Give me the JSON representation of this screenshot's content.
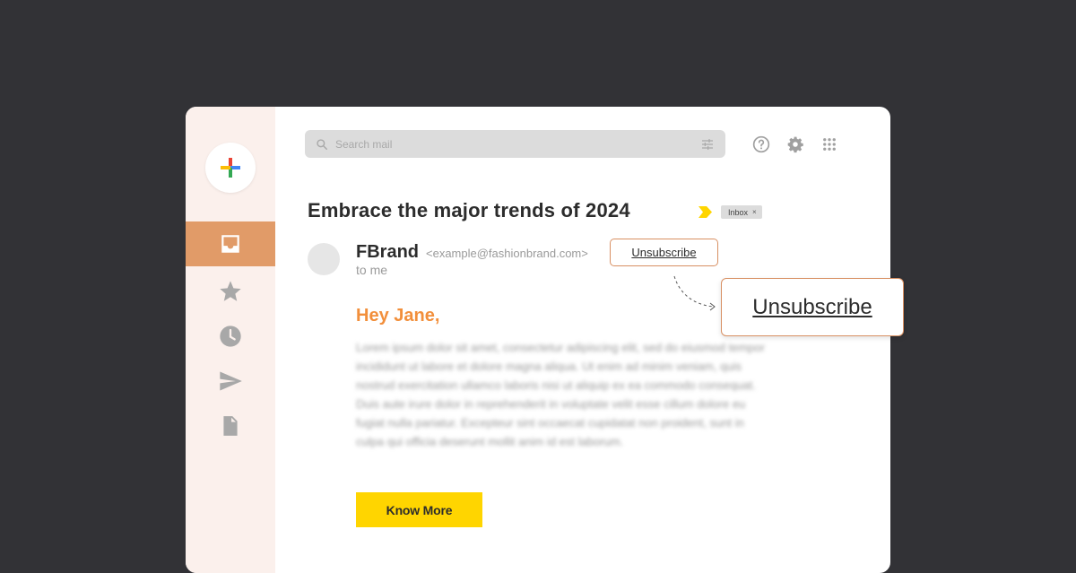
{
  "search": {
    "placeholder": "Search mail"
  },
  "header_icons": [
    "help-icon",
    "settings-icon",
    "apps-grid-icon"
  ],
  "sidebar": {
    "compose_icon": "plus-multicolor-icon",
    "items": [
      {
        "icon": "inbox-icon",
        "active": true
      },
      {
        "icon": "star-icon",
        "active": false
      },
      {
        "icon": "clock-icon",
        "active": false
      },
      {
        "icon": "send-icon",
        "active": false
      },
      {
        "icon": "document-icon",
        "active": false
      }
    ]
  },
  "email": {
    "subject": "Embrace the major trends of 2024",
    "label": "Inbox",
    "label_close": "×",
    "sender_name": "FBrand",
    "sender_email": "<example@fashionbrand.com>",
    "recipient": "to me",
    "unsubscribe_label": "Unsubscribe",
    "greeting": "Hey Jane,",
    "body": "Lorem ipsum dolor sit amet, consectetur adipiscing elit, sed do eiusmod tempor incididunt ut labore et dolore magna aliqua. Ut enim ad minim veniam, quis nostrud exercitation ullamco laboris nisi ut aliquip ex ea commodo consequat. Duis aute irure dolor in reprehenderit in voluptate velit esse cillum dolore eu fugiat nulla pariatur. Excepteur sint occaecat cupidatat non proident, sunt in culpa qui officia deserunt mollit anim id est laborum.",
    "cta_label": "Know More"
  },
  "callout": {
    "unsubscribe_label": "Unsubscribe"
  },
  "colors": {
    "background": "#323236",
    "sidebar": "#fbf0ec",
    "active_nav": "#e19b68",
    "accent_orange": "#f28f3b",
    "cta_yellow": "#ffd500",
    "label_arrow": "#ffd500",
    "outline": "#d89063"
  }
}
